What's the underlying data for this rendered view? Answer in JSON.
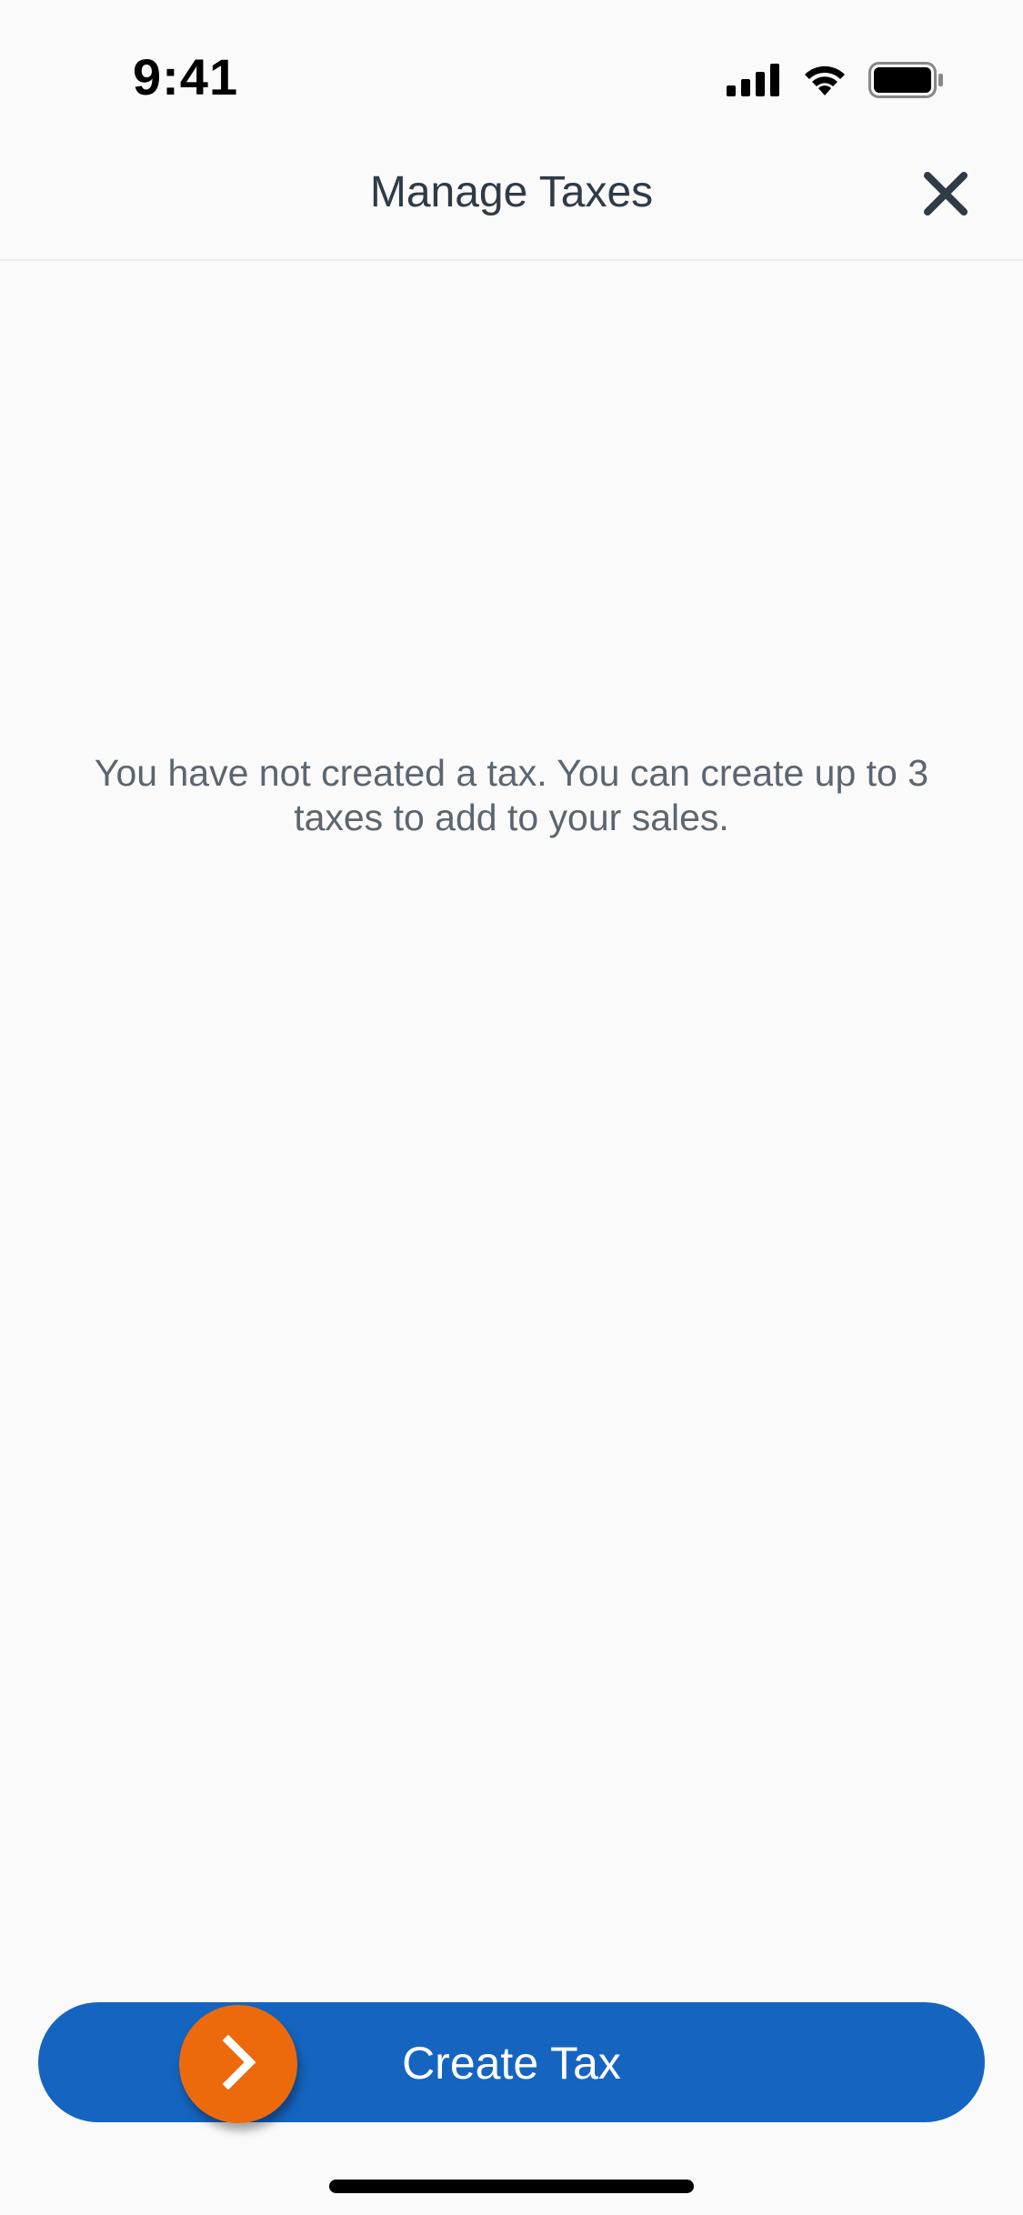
{
  "status_bar": {
    "time": "9:41",
    "icons": [
      "cellular-signal-icon",
      "wifi-icon",
      "battery-icon"
    ]
  },
  "header": {
    "title": "Manage Taxes",
    "close_icon": "close-icon"
  },
  "empty_state": {
    "message": "You have not created a tax. You can create up to 3 taxes to add to your sales."
  },
  "primary_action": {
    "label": "Create Tax",
    "icon": "chevron-right-icon"
  },
  "colors": {
    "background": "#fafafa",
    "primary_button": "#1565c0",
    "accent_circle": "#ec6a0c",
    "text_muted": "#5b6670",
    "text_title": "#2f3b46"
  }
}
